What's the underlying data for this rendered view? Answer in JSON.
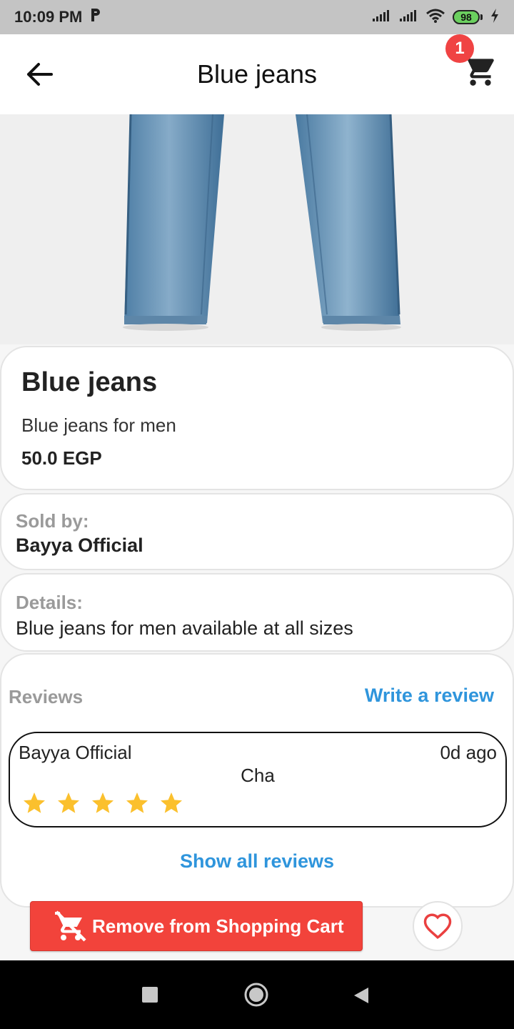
{
  "status_bar": {
    "time": "10:09 PM",
    "battery": "98"
  },
  "app_bar": {
    "title": "Blue jeans",
    "cart_count": "1"
  },
  "product": {
    "name": "Blue jeans",
    "short_description": "Blue jeans for men",
    "price": "50.0 EGP"
  },
  "seller": {
    "label": "Sold by:",
    "name": "Bayya Official"
  },
  "details": {
    "label": "Details:",
    "text": "Blue jeans for men available at all sizes"
  },
  "reviews": {
    "label": "Reviews",
    "write_label": "Write a review",
    "show_all_label": "Show all reviews",
    "items": [
      {
        "author": "Bayya Official",
        "time": "0d ago",
        "text": "Cha",
        "rating": 5
      }
    ]
  },
  "actions": {
    "remove_label": "Remove from Shopping Cart"
  },
  "colors": {
    "accent_blue": "#2f95dc",
    "danger_red": "#f2433b",
    "star_yellow": "#fbc02d",
    "badge_red": "#f04343"
  }
}
